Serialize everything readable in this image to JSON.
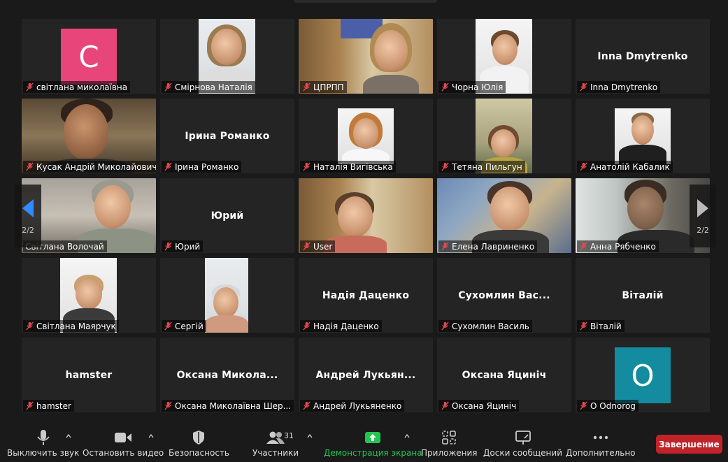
{
  "page": {
    "current": "2/2"
  },
  "participants": [
    {
      "label": "світлана миколаївна",
      "center": "",
      "avatar": "С",
      "avatar_color": "#e8457a"
    },
    {
      "label": "Смірнова Наталія",
      "center": ""
    },
    {
      "label": "ЦПРПП",
      "center": ""
    },
    {
      "label": "Чорна Юлія",
      "center": ""
    },
    {
      "label": "Inna Dmytrenko",
      "center": "Inna Dmytrenko"
    },
    {
      "label": "Кусак Андрій Миколайович",
      "center": ""
    },
    {
      "label": "Ірина Романко",
      "center": "Ірина Романко"
    },
    {
      "label": "Наталія Вигівська",
      "center": ""
    },
    {
      "label": "Тетяна Пильгун",
      "center": ""
    },
    {
      "label": "Анатолій Кабалик",
      "center": ""
    },
    {
      "label": "Світлана Волочай",
      "center": ""
    },
    {
      "label": "Юрий",
      "center": "Юрий"
    },
    {
      "label": "User",
      "center": ""
    },
    {
      "label": "Елена Лавриненко",
      "center": ""
    },
    {
      "label": "Анна Рябченко",
      "center": ""
    },
    {
      "label": "Світлана Маярчук",
      "center": ""
    },
    {
      "label": "Сергій",
      "center": ""
    },
    {
      "label": "Надія Даценко",
      "center": "Надія Даценко"
    },
    {
      "label": "Сухомлин Василь",
      "center": "Сухомлин  Вас..."
    },
    {
      "label": "Віталій",
      "center": "Віталій"
    },
    {
      "label": "hamster",
      "center": "hamster"
    },
    {
      "label": "Оксана Миколаївна Шер...",
      "center": "Оксана  Микола..."
    },
    {
      "label": "Андрей Лукьяненко",
      "center": "Андрей  Лукьян..."
    },
    {
      "label": "Оксана Яциніч",
      "center": "Оксана Яциніч"
    },
    {
      "label": "O Odnorog",
      "center": "",
      "avatar": "O",
      "avatar_color": "#128c9e"
    }
  ],
  "toolbar": {
    "mute": "Выключить звук",
    "video": "Остановить видео",
    "security": "Безопасность",
    "participants": "Участники",
    "participants_count": "31",
    "share": "Демонстрация экрана",
    "apps": "Приложения",
    "whiteboards": "Доски сообщений",
    "more": "Дополнительно",
    "end": "Завершение"
  },
  "colors": {
    "share_green": "#23c552",
    "end_red": "#c0232a",
    "mic_red": "#e5484d"
  }
}
